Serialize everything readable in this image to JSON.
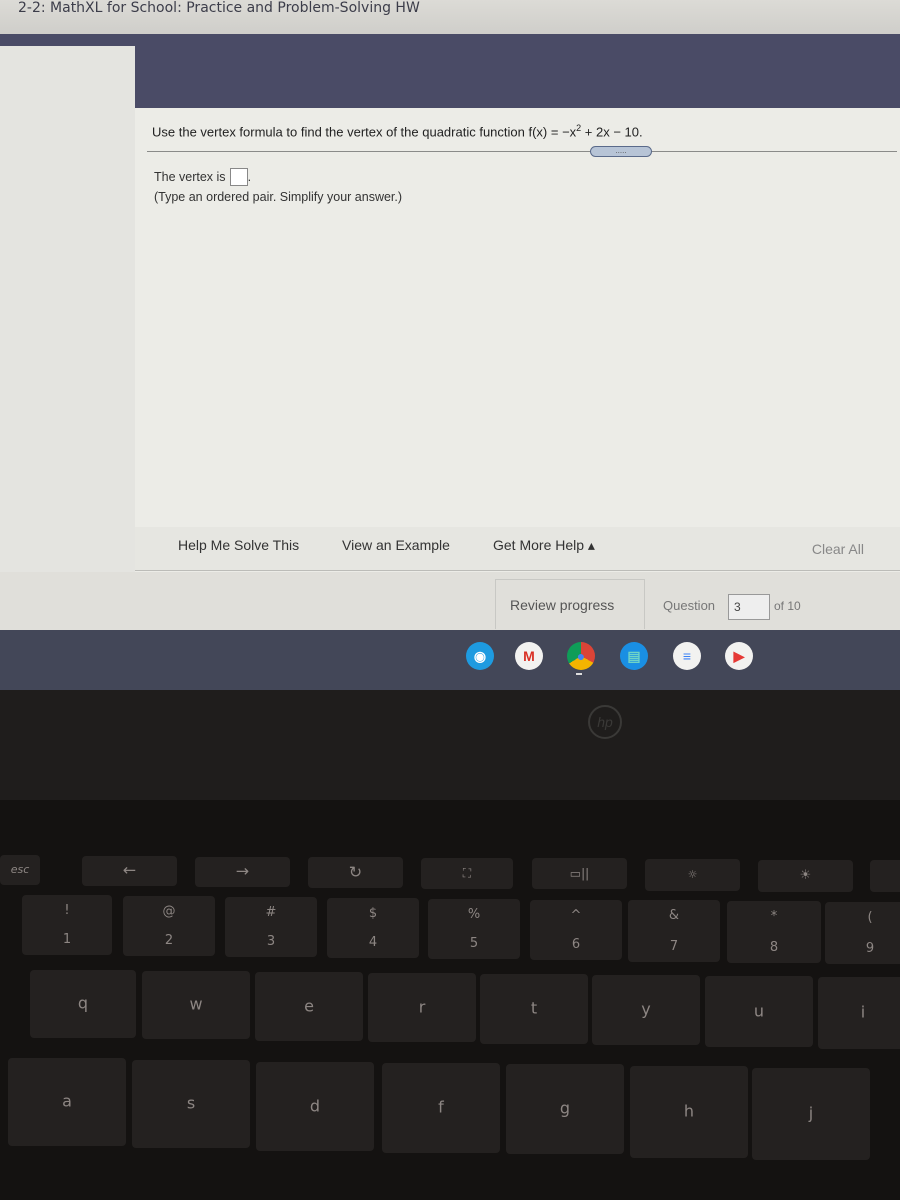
{
  "title_bar": {
    "title": "2-2: MathXL for School: Practice and Problem-Solving HW"
  },
  "question": {
    "prefix": "Use the vertex formula to find the vertex of the quadratic function f(x) = −x",
    "exponent": "2",
    "suffix": " + 2x − 10.",
    "more_button": ".....",
    "answer_prefix": "The vertex is",
    "answer_suffix": ".",
    "answer_value": "",
    "hint": "(Type an ordered pair. Simplify your answer.)"
  },
  "help_bar": {
    "help_me_solve": "Help Me Solve This",
    "view_example": "View an Example",
    "get_more_help": "Get More Help ▴",
    "clear_all": "Clear All"
  },
  "progress": {
    "review_progress": "Review progress",
    "question_label": "Question",
    "question_number": "3",
    "of_total": "of 10"
  },
  "shelf": {
    "apps": [
      {
        "name": "accessibility",
        "glyph": "◉",
        "color": "#1e9be0"
      },
      {
        "name": "gmail",
        "glyph": "M",
        "color": "#f2f2f0"
      },
      {
        "name": "chrome",
        "glyph": "●",
        "color": "#e8e8e6"
      },
      {
        "name": "files",
        "glyph": "▤",
        "color": "#1a8fe3"
      },
      {
        "name": "docs",
        "glyph": "≡",
        "color": "#f2f2f0"
      },
      {
        "name": "youtube",
        "glyph": "▶",
        "color": "#f2f2f0"
      }
    ]
  },
  "bezel": {
    "logo": "hp"
  },
  "keyboard": {
    "function_row": [
      "esc",
      "←",
      "→",
      "↻",
      "⛶",
      "▭||",
      "☼",
      "☀"
    ],
    "number_row": [
      {
        "top": "!",
        "bot": "1"
      },
      {
        "top": "@",
        "bot": "2"
      },
      {
        "top": "#",
        "bot": "3"
      },
      {
        "top": "$",
        "bot": "4"
      },
      {
        "top": "%",
        "bot": "5"
      },
      {
        "top": "^",
        "bot": "6"
      },
      {
        "top": "&",
        "bot": "7"
      },
      {
        "top": "*",
        "bot": "8"
      },
      {
        "top": "(",
        "bot": "9"
      }
    ],
    "qwerty_row": [
      "q",
      "w",
      "e",
      "r",
      "t",
      "y",
      "u",
      "i"
    ],
    "home_row": [
      "a",
      "s",
      "d",
      "f",
      "g",
      "h",
      "j"
    ]
  }
}
